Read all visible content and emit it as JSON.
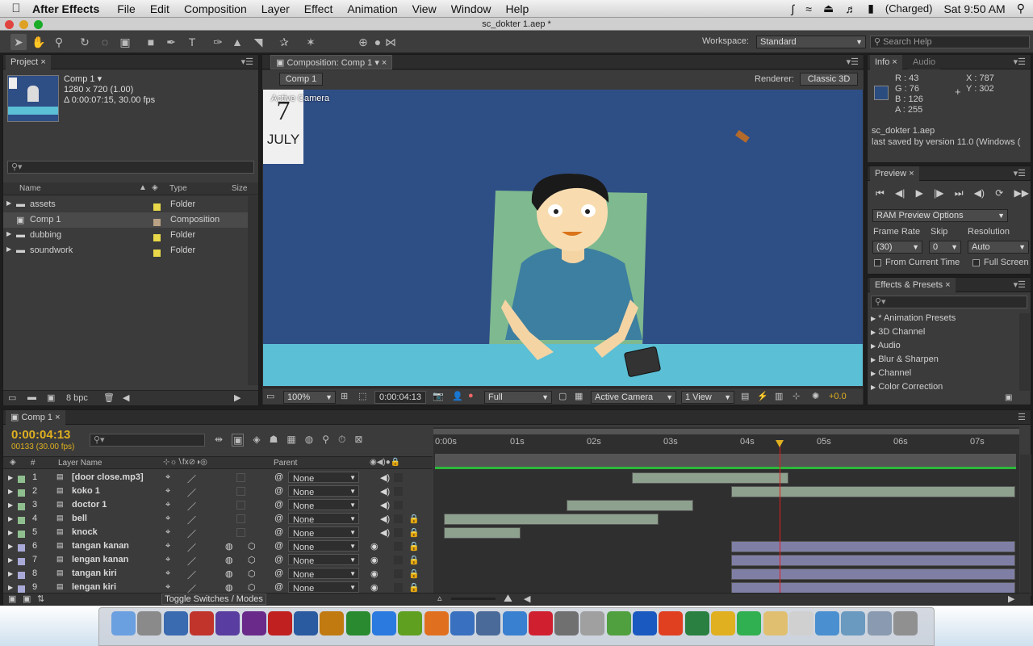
{
  "menubar": {
    "app": "After Effects",
    "items": [
      "File",
      "Edit",
      "Composition",
      "Layer",
      "Effect",
      "Animation",
      "View",
      "Window",
      "Help"
    ],
    "battery": "(Charged)",
    "clock": "Sat 9:50 AM"
  },
  "window_title": "sc_dokter 1.aep *",
  "toolbar": {
    "workspace_label": "Workspace:",
    "workspace_value": "Standard",
    "search_placeholder": "Search Help"
  },
  "project": {
    "tab": "Project",
    "comp_name": "Comp 1 ▾",
    "comp_size": "1280 x 720 (1.00)",
    "comp_duration": "Δ 0:00:07:15, 30.00 fps",
    "columns": {
      "name": "Name",
      "type": "Type",
      "size": "Size"
    },
    "items": [
      {
        "name": "assets",
        "type": "Folder",
        "color": "#e8d84a"
      },
      {
        "name": "Comp 1",
        "type": "Composition",
        "color": "#b8a184"
      },
      {
        "name": "dubbing",
        "type": "Folder",
        "color": "#e8d84a"
      },
      {
        "name": "soundwork",
        "type": "Folder",
        "color": "#e8d84a"
      }
    ],
    "bpc": "8 bpc"
  },
  "composition": {
    "tab": "Composition: Comp 1",
    "breadcrumb": "Comp 1",
    "renderer_label": "Renderer:",
    "renderer_value": "Classic 3D",
    "active_camera": "Active Camera",
    "calendar_day": "7",
    "calendar_month": "JULY",
    "footer": {
      "zoom": "100%",
      "timecode": "0:00:04:13",
      "resolution": "Full",
      "camera": "Active Camera",
      "views": "1 View",
      "exposure": "+0.0"
    }
  },
  "info": {
    "tab": "Info",
    "tab2": "Audio",
    "r": "R : 43",
    "g": "G : 76",
    "b": "B : 126",
    "a": "A : 255",
    "x": "X : 787",
    "y": "Y : 302",
    "color_swatch": "#2b4c7e",
    "file": "sc_dokter 1.aep",
    "saved": "last saved by version 11.0 (Windows ("
  },
  "preview": {
    "tab": "Preview",
    "ram_options": "RAM Preview Options",
    "frame_rate_label": "Frame Rate",
    "skip_label": "Skip",
    "resolution_label": "Resolution",
    "frame_rate": "(30)",
    "skip": "0",
    "resolution": "Auto",
    "from_current": "From Current Time",
    "full_screen": "Full Screen"
  },
  "effects": {
    "tab": "Effects & Presets",
    "items": [
      "* Animation Presets",
      "3D Channel",
      "Audio",
      "Blur & Sharpen",
      "Channel",
      "Color Correction"
    ]
  },
  "timeline": {
    "tab": "Comp 1",
    "timecode": "0:00:04:13",
    "frame_info": "00133 (30.00 fps)",
    "col_layer_name": "Layer Name",
    "col_parent": "Parent",
    "ruler": [
      "0:00s",
      "01s",
      "02s",
      "03s",
      "04s",
      "05s",
      "06s",
      "07s"
    ],
    "toggle": "Toggle Switches / Modes",
    "layers": [
      {
        "num": "1",
        "name": "[door close.mp3]",
        "parent": "None",
        "color": "#8fbf8f",
        "start": 2.5,
        "end": 4.55,
        "kind": "audio"
      },
      {
        "num": "2",
        "name": "koko 1",
        "parent": "None",
        "color": "#8fbf8f",
        "start": 3.8,
        "end": 7.5,
        "kind": "audio"
      },
      {
        "num": "3",
        "name": "doctor 1",
        "parent": "None",
        "color": "#8fbf8f",
        "start": 1.65,
        "end": 3.3,
        "kind": "audio"
      },
      {
        "num": "4",
        "name": "bell",
        "parent": "None",
        "color": "#8fbf8f",
        "start": 0.05,
        "end": 2.85,
        "kind": "audio"
      },
      {
        "num": "5",
        "name": "knock",
        "parent": "None",
        "color": "#8fbf8f",
        "start": 0.05,
        "end": 1.05,
        "kind": "audio"
      },
      {
        "num": "6",
        "name": "tangan kanan",
        "parent": "None",
        "color": "#a9a9d8",
        "start": 3.8,
        "end": 7.5,
        "kind": "video"
      },
      {
        "num": "7",
        "name": "lengan kanan",
        "parent": "None",
        "color": "#a9a9d8",
        "start": 3.8,
        "end": 7.5,
        "kind": "video"
      },
      {
        "num": "8",
        "name": "tangan kiri",
        "parent": "None",
        "color": "#a9a9d8",
        "start": 3.8,
        "end": 7.5,
        "kind": "video"
      },
      {
        "num": "9",
        "name": "lengan kiri",
        "parent": "None",
        "color": "#a9a9d8",
        "start": 3.8,
        "end": 7.5,
        "kind": "video"
      }
    ],
    "playhead_seconds": 4.43
  },
  "dock": [
    "Finder",
    "Dashboard",
    "Photos",
    "Audition",
    "Ae",
    "Pr",
    "Fl",
    "Ps",
    "Ai",
    "Dw",
    "App Store",
    "Utility",
    "Firefox",
    "iTunes",
    "Box",
    "Music",
    "PDF",
    "Calculator",
    "Preview",
    "uTorrent",
    "W",
    "P",
    "X",
    "O",
    "L",
    "Notes",
    "Documents",
    "Folder",
    "Downloads",
    "Screen",
    "Trash"
  ]
}
